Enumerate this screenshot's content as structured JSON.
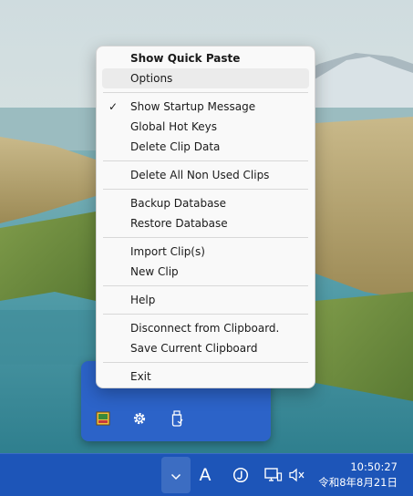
{
  "context_menu": {
    "items": [
      {
        "label": "Show Quick Paste",
        "bold": true
      },
      {
        "label": "Options",
        "highlighted": true
      },
      {
        "separator": true
      },
      {
        "label": "Show Startup Message",
        "checked": true
      },
      {
        "label": "Global Hot Keys"
      },
      {
        "label": "Delete Clip Data"
      },
      {
        "separator": true
      },
      {
        "label": "Delete All Non Used Clips"
      },
      {
        "separator": true
      },
      {
        "label": "Backup Database"
      },
      {
        "label": "Restore Database"
      },
      {
        "separator": true
      },
      {
        "label": "Import Clip(s)"
      },
      {
        "label": "New Clip"
      },
      {
        "separator": true
      },
      {
        "label": "Help"
      },
      {
        "separator": true
      },
      {
        "label": "Disconnect from Clipboard."
      },
      {
        "label": "Save Current Clipboard"
      },
      {
        "separator": true
      },
      {
        "label": "Exit"
      }
    ],
    "check_glyph": "✓"
  },
  "tray_flyout": {
    "icons": [
      "ditto-app-icon",
      "gear-icon",
      "usb-drive-icon"
    ]
  },
  "taskbar": {
    "ime_mode_label": "A",
    "clock": {
      "time": "10:50:27",
      "date": "令和8年8月21日"
    },
    "tray_icons": [
      "chevron-up-icon",
      "ime-mode-icon",
      "ime-circle-icon",
      "network-icon",
      "volume-muted-icon"
    ]
  },
  "colors": {
    "taskbar": "#1d55b8",
    "flyout": "#2c63c8",
    "menu_background": "#f9f9f9",
    "menu_highlight": "#ebebeb"
  }
}
